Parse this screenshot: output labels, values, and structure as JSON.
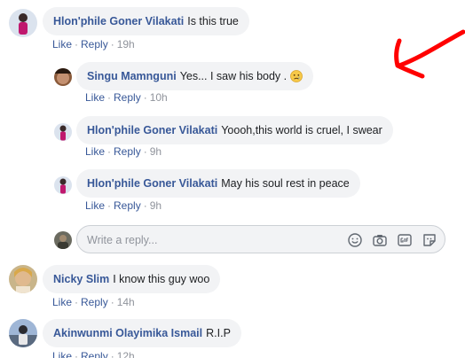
{
  "comments": [
    {
      "name": "Hlon'phile Goner Vilakati",
      "text": "Is this true",
      "like": "Like",
      "reply": "Reply",
      "time": "19h"
    },
    {
      "name": "Singu Mamnguni",
      "text": "Yes... I saw his body .",
      "like": "Like",
      "reply": "Reply",
      "time": "10h",
      "emoji": "crying-face"
    },
    {
      "name": "Hlon'phile Goner Vilakati",
      "text": "Yoooh,this world is cruel, I swear",
      "like": "Like",
      "reply": "Reply",
      "time": "9h"
    },
    {
      "name": "Hlon'phile Goner Vilakati",
      "text": "May his soul rest in peace",
      "like": "Like",
      "reply": "Reply",
      "time": "9h"
    },
    {
      "name": "Nicky Slim",
      "text": "I know this guy woo",
      "like": "Like",
      "reply": "Reply",
      "time": "14h"
    },
    {
      "name": "Akinwunmi Olayimika Ismail",
      "text": "R.I.P",
      "like": "Like",
      "reply": "Reply",
      "time": "12h"
    }
  ],
  "reply_box": {
    "placeholder": "Write a reply..."
  },
  "icons": [
    "emoji-icon",
    "camera-icon",
    "gif-icon",
    "sticker-icon"
  ],
  "colors": {
    "name": "#385898",
    "bubble": "#f2f3f5",
    "annotation_arrow": "#ff0000"
  }
}
